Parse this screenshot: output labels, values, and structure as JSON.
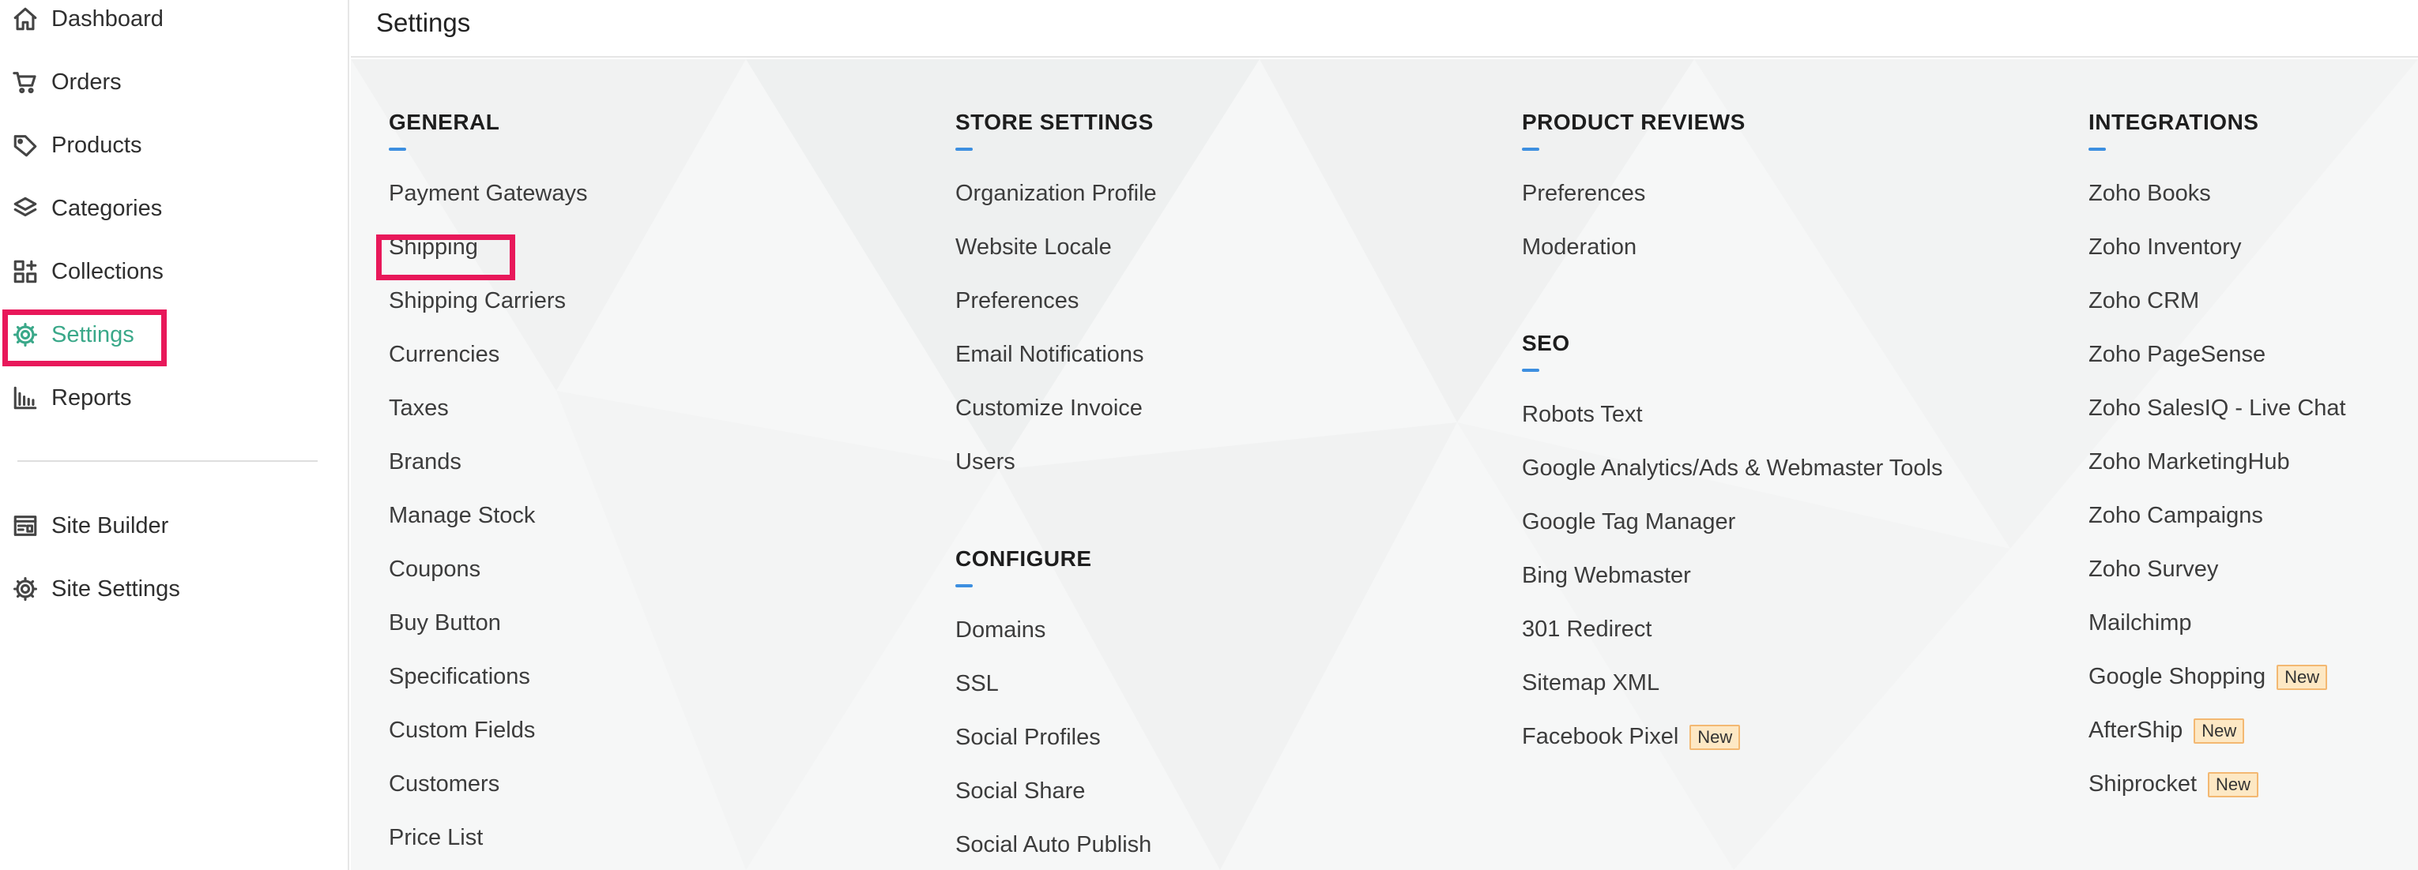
{
  "sidebar": {
    "items": [
      {
        "label": "Dashboard",
        "icon": "home-icon"
      },
      {
        "label": "Orders",
        "icon": "cart-icon"
      },
      {
        "label": "Products",
        "icon": "tag-icon"
      },
      {
        "label": "Categories",
        "icon": "layers-icon"
      },
      {
        "label": "Collections",
        "icon": "grid-icon"
      },
      {
        "label": "Settings",
        "icon": "gear-icon",
        "active": true
      },
      {
        "label": "Reports",
        "icon": "bar-chart-icon"
      }
    ],
    "secondary_items": [
      {
        "label": "Site Builder",
        "icon": "site-builder-icon"
      },
      {
        "label": "Site Settings",
        "icon": "gear-icon"
      }
    ]
  },
  "header": {
    "title": "Settings"
  },
  "columns": [
    {
      "sections": [
        {
          "title": "GENERAL",
          "links": [
            {
              "label": "Payment Gateways"
            },
            {
              "label": "Shipping",
              "highlighted": true
            },
            {
              "label": "Shipping Carriers"
            },
            {
              "label": "Currencies"
            },
            {
              "label": "Taxes"
            },
            {
              "label": "Brands"
            },
            {
              "label": "Manage Stock"
            },
            {
              "label": "Coupons"
            },
            {
              "label": "Buy Button"
            },
            {
              "label": "Specifications"
            },
            {
              "label": "Custom Fields"
            },
            {
              "label": "Customers"
            },
            {
              "label": "Price List"
            }
          ]
        }
      ]
    },
    {
      "sections": [
        {
          "title": "STORE SETTINGS",
          "links": [
            {
              "label": "Organization Profile"
            },
            {
              "label": "Website Locale"
            },
            {
              "label": "Preferences"
            },
            {
              "label": "Email Notifications"
            },
            {
              "label": "Customize Invoice"
            },
            {
              "label": "Users"
            }
          ]
        },
        {
          "title": "CONFIGURE",
          "links": [
            {
              "label": "Domains"
            },
            {
              "label": "SSL"
            },
            {
              "label": "Social Profiles"
            },
            {
              "label": "Social Share"
            },
            {
              "label": "Social Auto Publish"
            }
          ]
        }
      ]
    },
    {
      "sections": [
        {
          "title": "PRODUCT REVIEWS",
          "links": [
            {
              "label": "Preferences"
            },
            {
              "label": "Moderation"
            }
          ]
        },
        {
          "title": "SEO",
          "links": [
            {
              "label": "Robots Text"
            },
            {
              "label": "Google Analytics/Ads & Webmaster Tools"
            },
            {
              "label": "Google Tag Manager"
            },
            {
              "label": "Bing Webmaster"
            },
            {
              "label": "301 Redirect"
            },
            {
              "label": "Sitemap XML"
            },
            {
              "label": "Facebook Pixel",
              "badge": "New"
            }
          ]
        }
      ]
    },
    {
      "sections": [
        {
          "title": "INTEGRATIONS",
          "links": [
            {
              "label": "Zoho Books"
            },
            {
              "label": "Zoho Inventory"
            },
            {
              "label": "Zoho CRM"
            },
            {
              "label": "Zoho PageSense"
            },
            {
              "label": "Zoho SalesIQ - Live Chat"
            },
            {
              "label": "Zoho MarketingHub"
            },
            {
              "label": "Zoho Campaigns"
            },
            {
              "label": "Zoho Survey"
            },
            {
              "label": "Mailchimp"
            },
            {
              "label": "Google Shopping",
              "badge": "New"
            },
            {
              "label": "AfterShip",
              "badge": "New"
            },
            {
              "label": "Shiprocket",
              "badge": "New"
            }
          ]
        }
      ]
    }
  ],
  "colors": {
    "accent": "#3aa889",
    "highlight": "#e8185a",
    "underline": "#3d8fe0",
    "badge_bg": "#fde8c4",
    "badge_border": "#f3b872"
  }
}
